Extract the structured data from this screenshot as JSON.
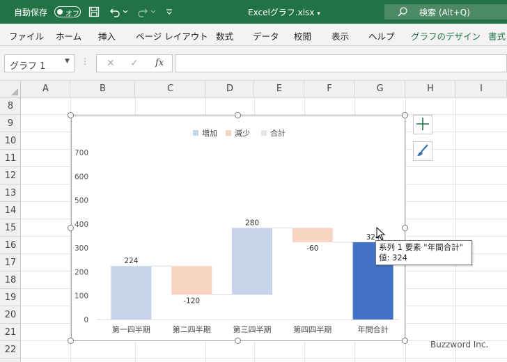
{
  "titlebar": {
    "autosave_label": "自動保存",
    "autosave_state": "オフ",
    "filename": "Excelグラフ.xlsx",
    "search_label": "検索 (Alt+Q)"
  },
  "ribbon": {
    "tabs": [
      "ファイル",
      "ホーム",
      "挿入",
      "ページ レイアウト",
      "数式",
      "データ",
      "校閲",
      "表示",
      "ヘルプ",
      "グラフのデザイン",
      "書式"
    ]
  },
  "formula": {
    "name_box": "グラフ 1",
    "fx": "fx"
  },
  "grid": {
    "columns": [
      "A",
      "B",
      "C",
      "D",
      "E",
      "F",
      "G",
      "H",
      "I"
    ],
    "rows": [
      "8",
      "9",
      "10",
      "11",
      "12",
      "13",
      "14",
      "15",
      "16",
      "17",
      "18",
      "19",
      "20",
      "21",
      "22"
    ]
  },
  "chart_data": {
    "type": "bar",
    "subtype": "waterfall",
    "legend": [
      "増加",
      "減少",
      "合計"
    ],
    "legend_colors": [
      "#c5d3ea",
      "#f7d3bf",
      "#e7e7e7"
    ],
    "categories": [
      "第一四半期",
      "第二四半期",
      "第三四半期",
      "第四四半期",
      "年間合計"
    ],
    "values": [
      224,
      -120,
      280,
      -60,
      324
    ],
    "data_labels": [
      "224",
      "-120",
      "280",
      "-60",
      "324"
    ],
    "kinds": [
      "increase",
      "decrease",
      "increase",
      "decrease",
      "total"
    ],
    "colors": {
      "increase": "#c6d4ea",
      "decrease": "#f8d5c2",
      "total": "#4472c4"
    },
    "ylim": [
      0,
      700
    ],
    "yticks": [
      "700",
      "600",
      "500",
      "400",
      "300",
      "200",
      "100",
      "0"
    ],
    "legend_position": "top"
  },
  "tooltip": {
    "line1": "系列 1 要素 \"年間合計\"",
    "line2": "値: 324"
  },
  "watermark": "Buzzword Inc."
}
